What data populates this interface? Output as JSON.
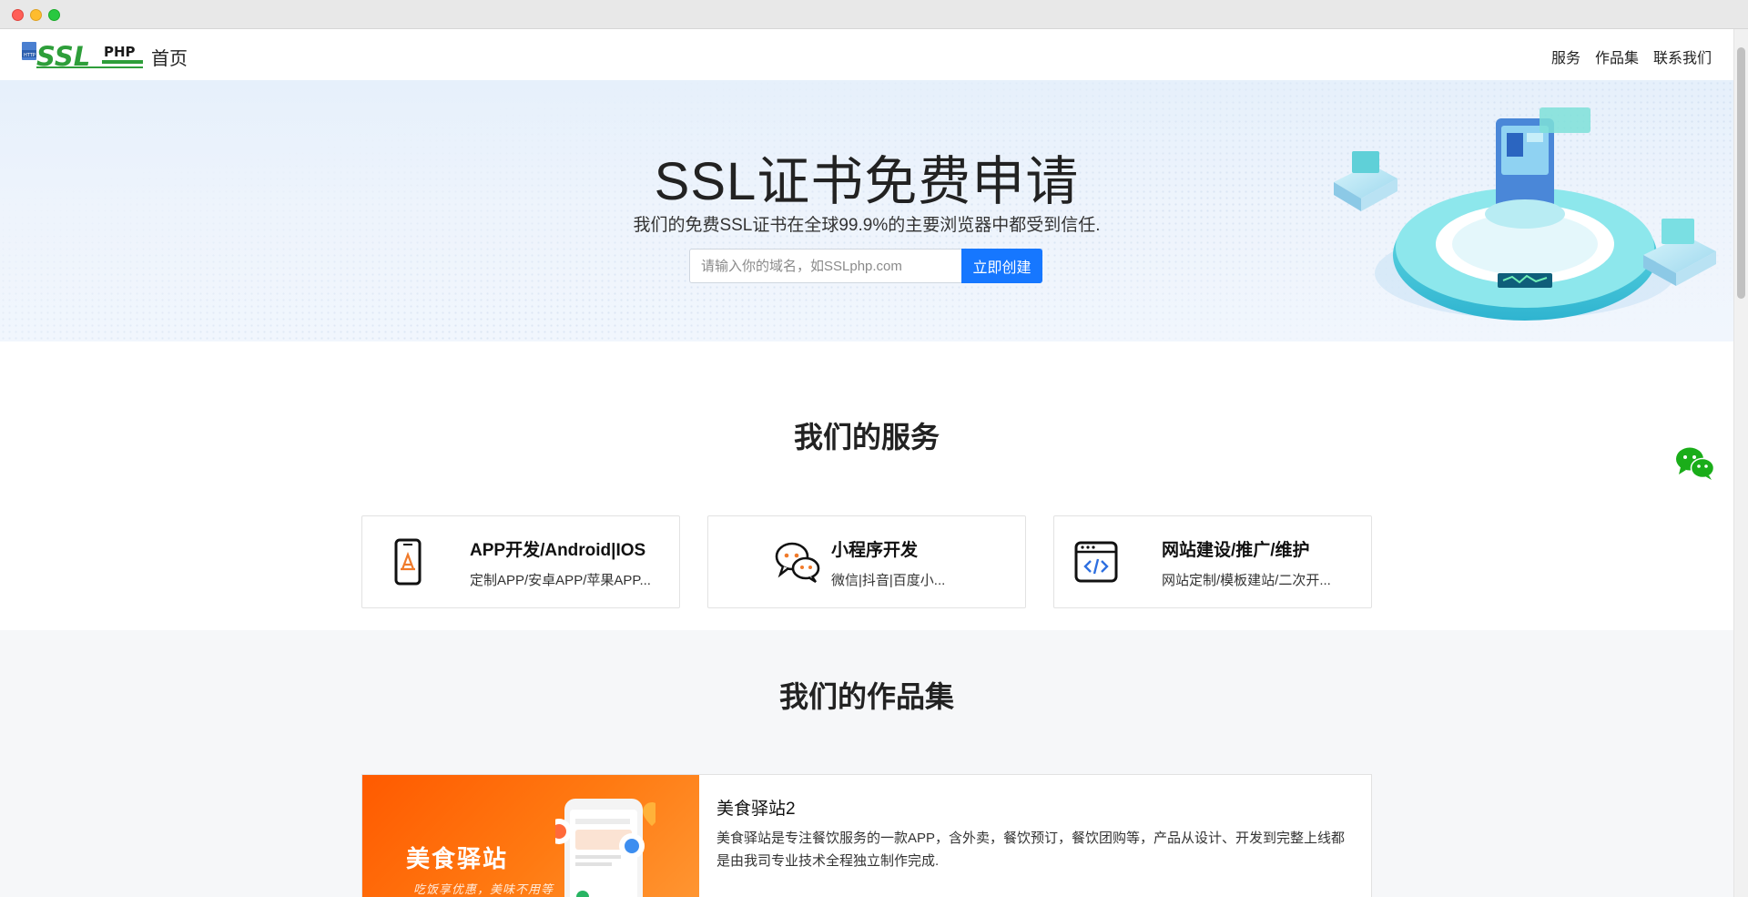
{
  "nav": {
    "logo_alt": "SSLPHP",
    "logo_badge": "HTTP",
    "logo_ssl": "SSL",
    "logo_php": "PHP",
    "home": "首页",
    "links": [
      "服务",
      "作品集",
      "联系我们"
    ]
  },
  "hero": {
    "title": "SSL证书免费申请",
    "subtitle": "我们的免费SSL证书在全球99.9%的主要浏览器中都受到信任.",
    "input_placeholder": "请输入你的域名，如SSLphp.com",
    "button": "立即创建"
  },
  "services": {
    "title": "我们的服务",
    "items": [
      {
        "icon": "phone-app-icon",
        "title": "APP开发/Android|IOS",
        "desc": "定制APP/安卓APP/苹果APP..."
      },
      {
        "icon": "chat-bubbles-icon",
        "title": "小程序开发",
        "desc": "微信|抖音|百度小..."
      },
      {
        "icon": "code-window-icon",
        "title": "网站建设/推广/维护",
        "desc": "网站定制/模板建站/二次开..."
      }
    ]
  },
  "portfolio": {
    "title": "我们的作品集",
    "items": [
      {
        "thumb_name": "美食驿站",
        "thumb_slogan": "吃饭享优惠，美味不用等",
        "title": "美食驿站2",
        "desc": "美食驿站是专注餐饮服务的一款APP，含外卖，餐饮预订，餐饮团购等，产品从设计、开发到完整上线都是由我司专业技术全程独立制作完成."
      }
    ]
  },
  "colors": {
    "accent": "#1677ff",
    "logo_green": "#2e9e3a",
    "portfolio_orange": "#ff6a0a",
    "wechat_green": "#1aad19"
  }
}
